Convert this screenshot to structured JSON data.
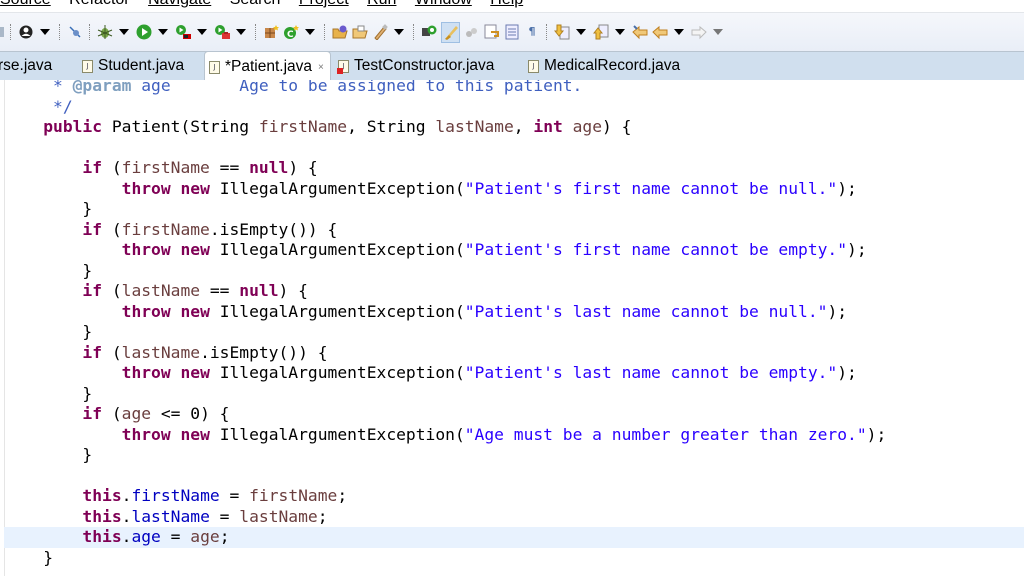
{
  "menu": {
    "items": [
      {
        "label": "Source",
        "mnemonic_index": 0
      },
      {
        "label": "Refactor",
        "mnemonic_index": 5
      },
      {
        "label": "Navigate",
        "mnemonic_index": 0
      },
      {
        "label": "Search",
        "mnemonic_index": 2
      },
      {
        "label": "Project",
        "mnemonic_index": 0
      },
      {
        "label": "Run",
        "mnemonic_index": 0
      },
      {
        "label": "Window",
        "mnemonic_index": 0
      },
      {
        "label": "Help",
        "mnemonic_index": 0
      }
    ]
  },
  "toolbar": {
    "icons": [
      "save-all-icon",
      "profile-icon",
      "skip-breakpoints-icon",
      "debug-icon",
      "run-icon",
      "run-last-tool-icon",
      "external-tools-icon",
      "new-java-package-icon",
      "new-java-class-icon",
      "open-type-icon",
      "open-task-icon",
      "search-icon",
      "toggle-ant-editor-icon",
      "mark-occurrences-icon",
      "toggle-block-selection-icon",
      "show-whitespace-icon",
      "next-annotation-icon",
      "previous-annotation-icon",
      "last-edit-location-icon",
      "back-icon",
      "forward-icon"
    ]
  },
  "tabs": [
    {
      "label": "rse.java",
      "active": false,
      "dirty": false,
      "error": false
    },
    {
      "label": "Student.java",
      "active": false,
      "dirty": false,
      "error": false
    },
    {
      "label": "*Patient.java",
      "active": true,
      "dirty": true,
      "error": false,
      "close_glyph": "×"
    },
    {
      "label": "TestConstructor.java",
      "active": false,
      "dirty": false,
      "error": true
    },
    {
      "label": "MedicalRecord.java",
      "active": false,
      "dirty": false,
      "error": false
    }
  ],
  "editor": {
    "current_line_index": 22,
    "lines": [
      "     * @param age       Age to be assigned to this patient.",
      "     */",
      "    public Patient(String firstName, String lastName, int age) {",
      "",
      "        if (firstName == null) {",
      "            throw new IllegalArgumentException(\"Patient's first name cannot be null.\");",
      "        }",
      "        if (firstName.isEmpty()) {",
      "            throw new IllegalArgumentException(\"Patient's first name cannot be empty.\");",
      "        }",
      "        if (lastName == null) {",
      "            throw new IllegalArgumentException(\"Patient's last name cannot be null.\");",
      "        }",
      "        if (lastName.isEmpty()) {",
      "            throw new IllegalArgumentException(\"Patient's last name cannot be empty.\");",
      "        }",
      "        if (age <= 0) {",
      "            throw new IllegalArgumentException(\"Age must be a number greater than zero.\");",
      "        }",
      "",
      "        this.firstName = firstName;",
      "        this.lastName = lastName;",
      "        this.age = age;",
      "    }"
    ]
  },
  "colors": {
    "keyword": "#7f0055",
    "string": "#2a00ff",
    "field": "#0000c0",
    "local_variable": "#6a3e3e",
    "javadoc": "#3f5fbf",
    "current_line": "#e8f2fe",
    "tab_bar": "#d0dfee"
  }
}
